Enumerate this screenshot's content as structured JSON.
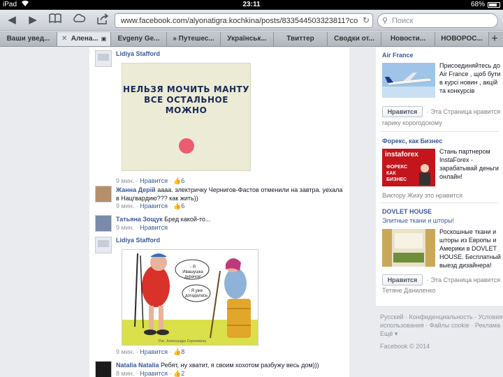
{
  "status_bar": {
    "device": "iPad",
    "time": "23:11",
    "battery": "68%",
    "battery_level": 0.68
  },
  "toolbar": {
    "back_icon": "◀",
    "forward_icon": "▶",
    "bookmarks_icon": "📖",
    "cloud_icon": "☁",
    "share_icon": "↗",
    "url": "www.facebook.com/alyonatigra.kochkina/posts/833544503323811?comm",
    "search_placeholder": "Поиск"
  },
  "tabs": [
    {
      "label": "Ваши увед..."
    },
    {
      "label": "Алена...",
      "close": "✕",
      "lock": "🔒"
    },
    {
      "label": "Evgeny Ge..."
    },
    {
      "label": "» Путешес..."
    },
    {
      "label": "Українськ..."
    },
    {
      "label": "Твиттер"
    },
    {
      "label": "Сводки от..."
    },
    {
      "label": "Новости..."
    },
    {
      "label": "НОВОРОС..."
    }
  ],
  "feed": {
    "c1": {
      "author": "Lidiya Stafford",
      "image_text": "НЕЛЬЗЯ МОЧИТЬ МАНТУ ВСЕ ОСТАЛЬНОЕ МОЖНО",
      "time": "9 мин.",
      "sep": "·",
      "like": "Нравится",
      "sep2": "·",
      "likes": "6"
    },
    "c2": {
      "author": "Жанна Дерій",
      "text": "аааа. электричку Чернигов-Фастов отменили на завтра. уехала в Нацгвардию??? как жить))",
      "time": "9 мин.",
      "sep": "·",
      "like": "Нравится",
      "sep2": "·",
      "likes": "6"
    },
    "c3": {
      "author": "Татьяна Зощук",
      "text": "Бред какой-то...",
      "time": "9 мин.",
      "sep": "·",
      "like": "Нравится"
    },
    "c4": {
      "author": "Lidiya Stafford",
      "bubble1": "- Я Ивашушка дурачок!",
      "bubble2": "- Я уже догадалась",
      "signature": "Рис. Александра Сергеевича",
      "time": "9 мин.",
      "sep": "·",
      "like": "Нравится",
      "sep2": "·",
      "likes": "8"
    },
    "c5": {
      "author": "Natalia Natalia",
      "text": "Ребят, ну хватит, я своим хохотом разбужу весь дом)))",
      "time": "8 мин.",
      "sep": "·",
      "like": "Нравится",
      "sep2": "·",
      "likes": "2"
    }
  },
  "ads": [
    {
      "title": "Air France",
      "body": "Присоединяйтесь до Air France , щоб бути в курсі новин , акцій та конкурсів",
      "like_button": "Нравится",
      "likes_text": "· Эта Страница нравится",
      "social": "гарику корогодскому"
    },
    {
      "title": "Форекс, как Бизнес",
      "img_brand": "instaforex",
      "img_caption": "ФОРЕКС КАК БИЗНЕС",
      "body": "Стань партнером InstaForex - зарабатывай деньги онлайн!",
      "social": "Виктору Жиху это нравится"
    },
    {
      "title": "DOVLET HOUSE",
      "subtitle": "Элитные ткани и шторы!",
      "body": "Роскошные ткани и шторы из Европы и Америки в DOVLET HOUSE. Бесплатный выезд дизайнера!",
      "like_button": "Нравится",
      "likes_text": "· Эта Страница нравится",
      "social": "Тетяне Даниленко"
    }
  ],
  "footer": {
    "line1": "Русский · Конфиденциальность · Условия",
    "line2": "использования · Файлы cookie · Реклама ·",
    "line3": "Ещё ▾",
    "copyright": "Facebook © 2014"
  }
}
